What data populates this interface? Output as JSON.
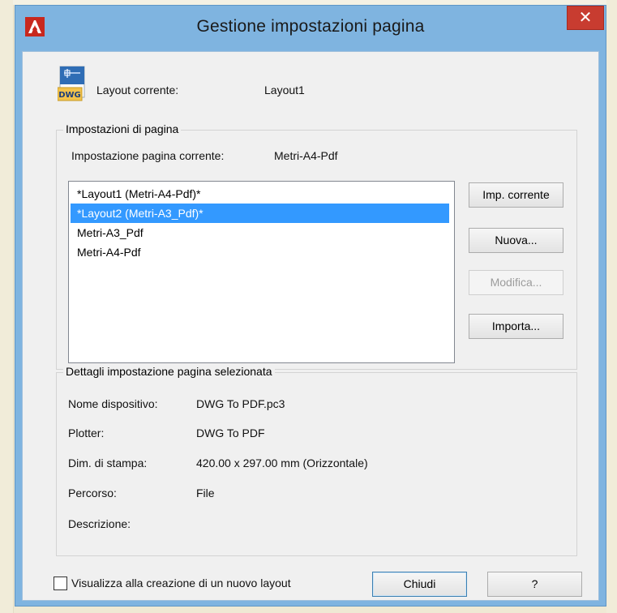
{
  "dialog": {
    "title": "Gestione impostazioni pagina",
    "close_label": "✕",
    "colors": {
      "titlebar": "#7fb4e0",
      "close": "#c83c30",
      "selection": "#3399ff"
    }
  },
  "current_layout": {
    "label": "Layout corrente:",
    "value": "Layout1",
    "icon": "dwg-file-icon",
    "icon_text": "DWG"
  },
  "page_setups": {
    "group_label": "Impostazioni di pagina",
    "current_label": "Impostazione pagina corrente:",
    "current_value": "Metri-A4-Pdf",
    "list": [
      "*Layout1 (Metri-A4-Pdf)*",
      "*Layout2 (Metri-A3_Pdf)*",
      "Metri-A3_Pdf",
      "Metri-A4-Pdf"
    ],
    "selected_index": 1,
    "buttons": {
      "set_current": "Imp. corrente",
      "new": "Nuova...",
      "modify": "Modifica...",
      "import": "Importa..."
    }
  },
  "details": {
    "group_label": "Dettagli impostazione pagina selezionata",
    "rows": [
      {
        "label": "Nome dispositivo:",
        "value": "DWG To PDF.pc3"
      },
      {
        "label": "Plotter:",
        "value": "DWG To PDF"
      },
      {
        "label": "Dim. di stampa:",
        "value": "420.00 x 297.00 mm (Orizzontale)"
      },
      {
        "label": "Percorso:",
        "value": "File"
      },
      {
        "label": "Descrizione:",
        "value": ""
      }
    ]
  },
  "footer": {
    "checkbox_label": "Visualizza alla creazione di un nuovo layout",
    "checkbox_checked": false,
    "close_button": "Chiudi",
    "help_button": "?"
  }
}
